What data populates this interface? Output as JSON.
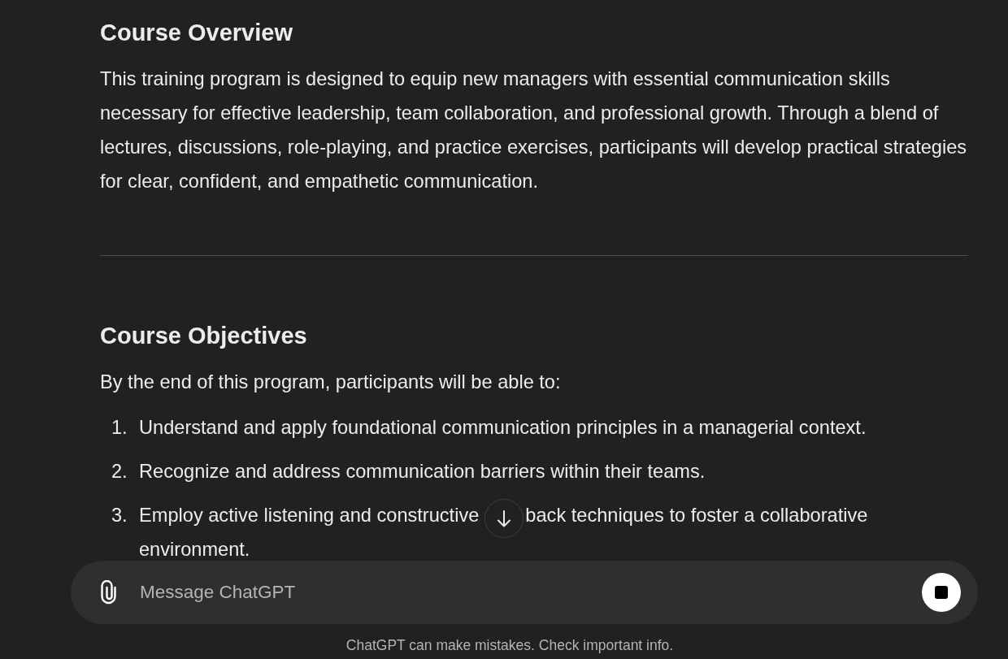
{
  "sections": [
    {
      "heading": "Course Overview",
      "blocks": [
        {
          "kind": "paragraph",
          "text": "This training program is designed to equip new managers with essential communication skills necessary for effective leadership, team collaboration, and professional growth. Through a blend of lectures, discussions, role-playing, and practice exercises, participants will develop practical strategies for clear, confident, and empathetic communication."
        }
      ]
    },
    {
      "heading": "Course Objectives",
      "blocks": [
        {
          "kind": "paragraph",
          "text": "By the end of this program, participants will be able to:"
        },
        {
          "kind": "list",
          "items": [
            {
              "number": "1.",
              "text": "Understand and apply foundational communication principles in a managerial context."
            },
            {
              "number": "2.",
              "text": "Recognize and address communication barriers within their teams."
            },
            {
              "number": "3.",
              "text": "Employ active listening and constructive",
              "text_after_scroll_button": "back techniques to foster a collaborative",
              "continuation": "environment."
            }
          ]
        }
      ]
    }
  ],
  "composer": {
    "placeholder": "Message ChatGPT"
  },
  "footer": "ChatGPT can make mistakes. Check important info."
}
